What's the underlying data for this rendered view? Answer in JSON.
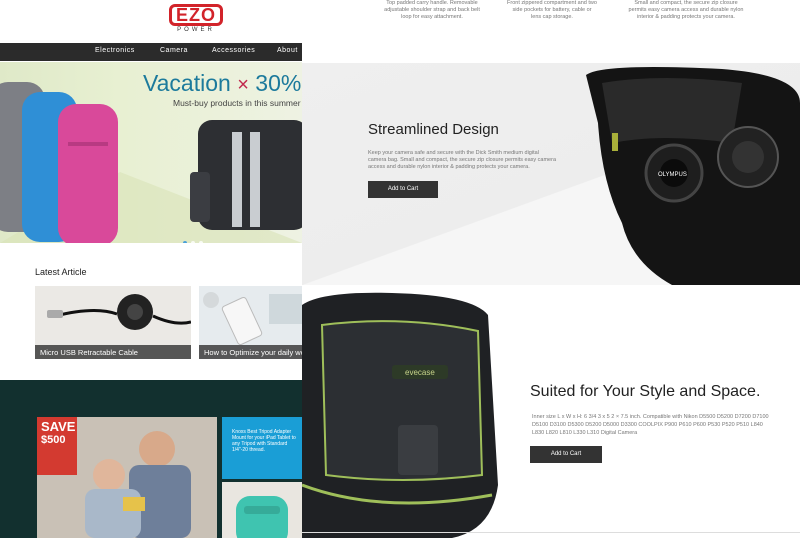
{
  "left": {
    "logo": {
      "main": "EZO",
      "sub": "POWER"
    },
    "nav": [
      "Electronics",
      "Camera",
      "Accessories",
      "About"
    ],
    "hero": {
      "title_word": "Vacation",
      "title_x": "×",
      "title_pct": "30%",
      "subtitle": "Must-buy products in this summer va"
    },
    "latest_heading": "Latest Article",
    "articles": [
      {
        "caption": "Micro USB Retractable Cable"
      },
      {
        "caption": "How to Optimize your daily wo"
      }
    ],
    "promo": {
      "save": "SAVE",
      "upto": "UP TO",
      "amount": "$500"
    },
    "tile_text": "Knoxs Best Tripod Adapter Mount for your iPad Tablet to any Tripod with Standard 1/4\"-20 thread."
  },
  "right": {
    "strip": [
      "Top padded carry handle. Removable adjustable shoulder strap and back belt loop for easy attachment.",
      "Front zippered compartment and two side pockets for battery, cable or lens cap storage.",
      "Small and compact, the secure zip closure permits easy camera access and durable nylon interior & padding protects your camera."
    ],
    "section1": {
      "title": "Streamlined Design",
      "body": "Keep your camera safe and secure with the Dick Smith medium digital camera bag. Small and compact, the secure zip closure permits easy camera access and durable nylon interior & padding protects your camera.",
      "button": "Add to Cart",
      "lens_brand": "OLYMPUS"
    },
    "section2": {
      "title": "Suited for Your Style and Space.",
      "body": "Inner size L x W x H: 6 3/4 3 x 5 2 × 7.5 inch. Compatible with Nikon D5500 D5200 D7200 D7100 D5100 D3100 D5300 D5200 D5000 D3300 COOLPIX P900 P610 P600 P530 P520 P510 L840 L830 L820 L810 L330 L310 Digital Camera",
      "button": "Add to Cart",
      "bag_brand": "evecase"
    }
  },
  "colors": {
    "accent_red": "#d2232a",
    "nav_bg": "#2b2b2b",
    "button_bg": "#333333",
    "dark_section": "#12302f"
  }
}
